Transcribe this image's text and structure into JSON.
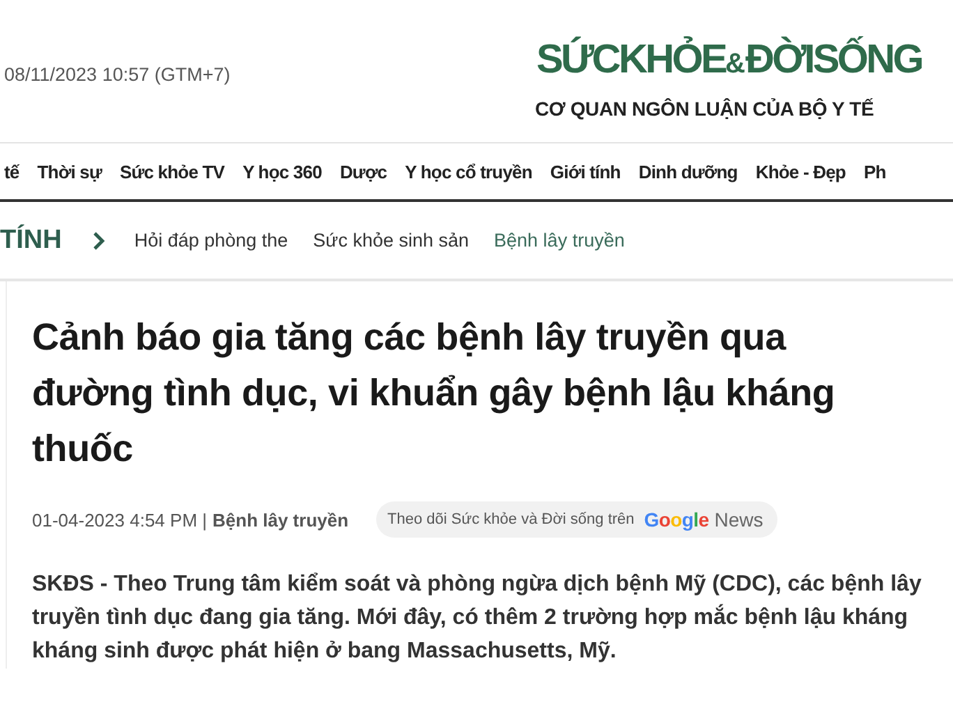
{
  "header": {
    "datetime": "08/11/2023 10:57 (GTM+7)",
    "logo": {
      "left": "SỨCKHỎE",
      "amp": "&",
      "right": "ĐỜISỐNG",
      "tagline": "CƠ QUAN NGÔN LUẬN CỦA BỘ Y TẾ"
    }
  },
  "nav": {
    "items": [
      "tế",
      "Thời sự",
      "Sức khỏe TV",
      "Y học 360",
      "Dược",
      "Y học cổ truyền",
      "Giới tính",
      "Dinh dưỡng",
      "Khỏe - Đẹp",
      "Ph"
    ]
  },
  "breadcrumb": {
    "section": "TÍNH",
    "items": [
      {
        "label": "Hỏi đáp phòng the",
        "selected": false
      },
      {
        "label": "Sức khỏe sinh sản",
        "selected": false
      },
      {
        "label": "Bệnh lây truyền",
        "selected": true
      }
    ]
  },
  "article": {
    "title": "Cảnh báo gia tăng các bệnh lây truyền qua đường tình dục, vi khuẩn gây bệnh lậu kháng thuốc",
    "date": "01-04-2023 4:54 PM |",
    "category": "Bệnh lây truyền",
    "follow": {
      "text": "Theo dõi Sức khỏe và Đời sống trên",
      "brand": "Google",
      "suffix": "News"
    },
    "lead": "SKĐS - Theo Trung tâm kiểm soát và phòng ngừa dịch bệnh Mỹ (CDC), các bệnh lây truyền tình dục đang gia tăng. Mới đây, có thêm 2 trường hợp mắc bệnh lậu kháng kháng sinh được phát hiện ở bang Massachusetts, Mỹ."
  }
}
